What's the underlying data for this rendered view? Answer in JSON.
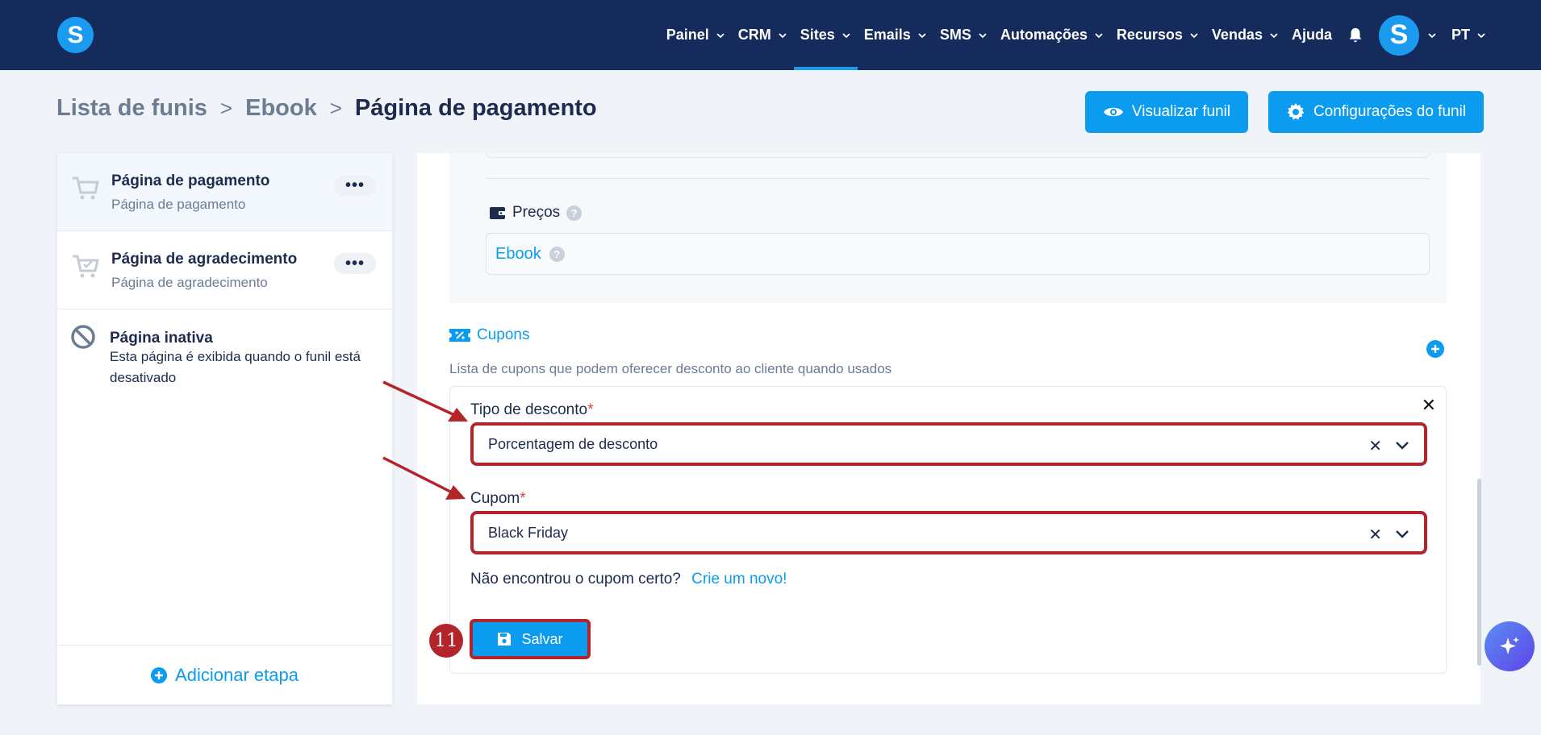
{
  "nav": {
    "logo": "S",
    "items": [
      {
        "label": "Painel"
      },
      {
        "label": "CRM"
      },
      {
        "label": "Sites",
        "active": true
      },
      {
        "label": "Emails"
      },
      {
        "label": "SMS"
      },
      {
        "label": "Automações"
      },
      {
        "label": "Recursos"
      },
      {
        "label": "Vendas"
      }
    ],
    "help": "Ajuda",
    "avatar_letter": "S",
    "language": "PT"
  },
  "breadcrumb": {
    "level1": "Lista de funis",
    "level2": "Ebook",
    "current": "Página de pagamento",
    "separator": ">"
  },
  "header_actions": {
    "view_funnel": "Visualizar funil",
    "funnel_settings": "Configurações do funil"
  },
  "sidebar": {
    "steps": [
      {
        "title": "Página de pagamento",
        "subtitle": "Página de pagamento",
        "menu": "•••"
      },
      {
        "title": "Página de agradecimento",
        "subtitle": "Página de agradecimento",
        "menu": "•••"
      }
    ],
    "inactive": {
      "title": "Página inativa",
      "description": "Esta página é exibida quando o funil está desativado"
    },
    "add_step": "Adicionar etapa"
  },
  "main": {
    "precos": {
      "label": "Preços",
      "help": "?",
      "value": "Ebook"
    },
    "cupons": {
      "title": "Cupons",
      "description": "Lista de cupons que podem oferecer desconto ao cliente quando usados",
      "discount_type": {
        "label": "Tipo de desconto",
        "required": "*",
        "value": "Porcentagem de desconto"
      },
      "coupon": {
        "label": "Cupom",
        "required": "*",
        "value": "Black Friday"
      },
      "not_found_text": "Não encontrou o cupom certo?",
      "create_link": "Crie um novo!",
      "save": "Salvar"
    }
  },
  "annotation": {
    "step_number": "11",
    "color": "#b3242b"
  },
  "colors": {
    "navbar": "#142b5c",
    "accent": "#0b9cf0",
    "highlight": "#b3242b"
  }
}
